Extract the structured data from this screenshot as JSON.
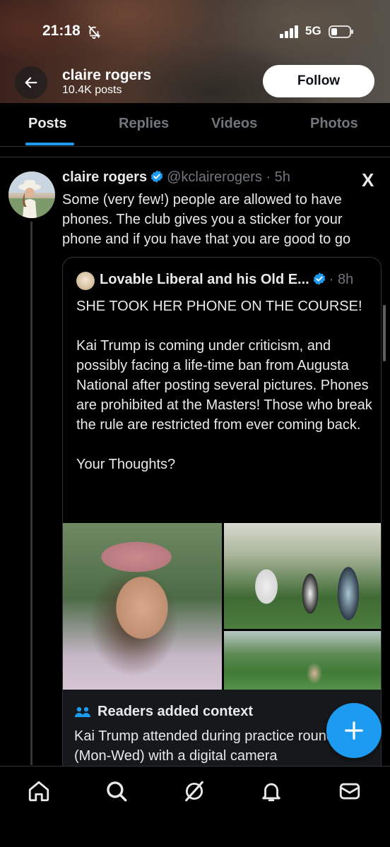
{
  "status_bar": {
    "time": "21:18",
    "network": "5G",
    "icons": [
      "bell-off-icon",
      "signal-icon",
      "battery-icon"
    ]
  },
  "header": {
    "name": "claire rogers",
    "post_count": "10.4K posts",
    "follow_label": "Follow",
    "back_icon": "arrow-left-icon"
  },
  "tabs": [
    {
      "label": "Posts",
      "active": true
    },
    {
      "label": "Replies",
      "active": false
    },
    {
      "label": "Videos",
      "active": false
    },
    {
      "label": "Photos",
      "active": false
    }
  ],
  "tweet": {
    "author_name": "claire rogers",
    "handle_time": "@kclairerogers · 5h",
    "verified": true,
    "source_logo": "X",
    "text": "Some (very few!) people are allowed to have phones. The club gives you a sticker for your phone and if you have that you are good to go"
  },
  "quote": {
    "author_name": "Lovable Liberal and his Old E...",
    "time": "· 8h",
    "verified": true,
    "text": "SHE TOOK HER PHONE ON THE COURSE!\n\nKai Trump is coming under criticism, and possibly facing a life-time ban from Augusta National after posting several pictures. Phones are prohibited at the Masters! Those who break the rule are restricted from ever coming back.\n\nYour Thoughts?",
    "image_count": 3
  },
  "context": {
    "title": "Readers added context",
    "text": "Kai Trump attended during practice rounds (Mon-Wed) with a digital camera"
  },
  "colors": {
    "accent": "#1d9bf0",
    "background": "#000000",
    "text": "#e7e9ea",
    "muted": "#71767b"
  },
  "bottom_nav": [
    "home-icon",
    "search-icon",
    "grok-icon",
    "notifications-icon",
    "messages-icon"
  ],
  "fab_icon": "plus-icon"
}
